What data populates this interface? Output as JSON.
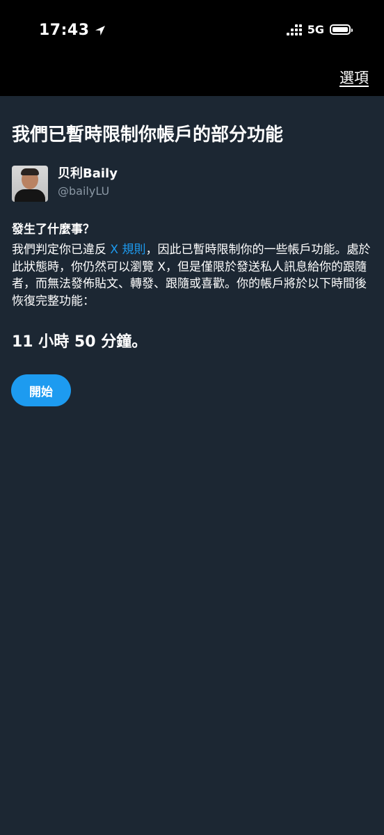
{
  "status_bar": {
    "time": "17:43",
    "network": "5G"
  },
  "header": {
    "options_label": "選項"
  },
  "main": {
    "title": "我們已暫時限制你帳戶的部分功能",
    "profile": {
      "display_name": "贝利Baily",
      "handle": "@bailyLU"
    },
    "section_heading": "發生了什麼事？",
    "body_before_link": "我們判定你已違反 ",
    "rules_link": "X 規則",
    "body_after_link": "，因此已暫時限制你的一些帳戶功能。處於此狀態時，你仍然可以瀏覽 X，但是僅限於發送私人訊息給你的跟隨者，而無法發佈貼文、轉發、跟隨或喜歡。你的帳戶將於以下時間後恢復完整功能：",
    "countdown": "11 小時 50 分鐘。",
    "start_button": "開始"
  },
  "colors": {
    "background": "#1c2733",
    "top_bar": "#000000",
    "accent": "#1d9bf0",
    "secondary_text": "#8b98a5"
  },
  "icons": {
    "location": "location-arrow-icon",
    "signal": "signal-dots-icon",
    "battery": "battery-icon"
  }
}
